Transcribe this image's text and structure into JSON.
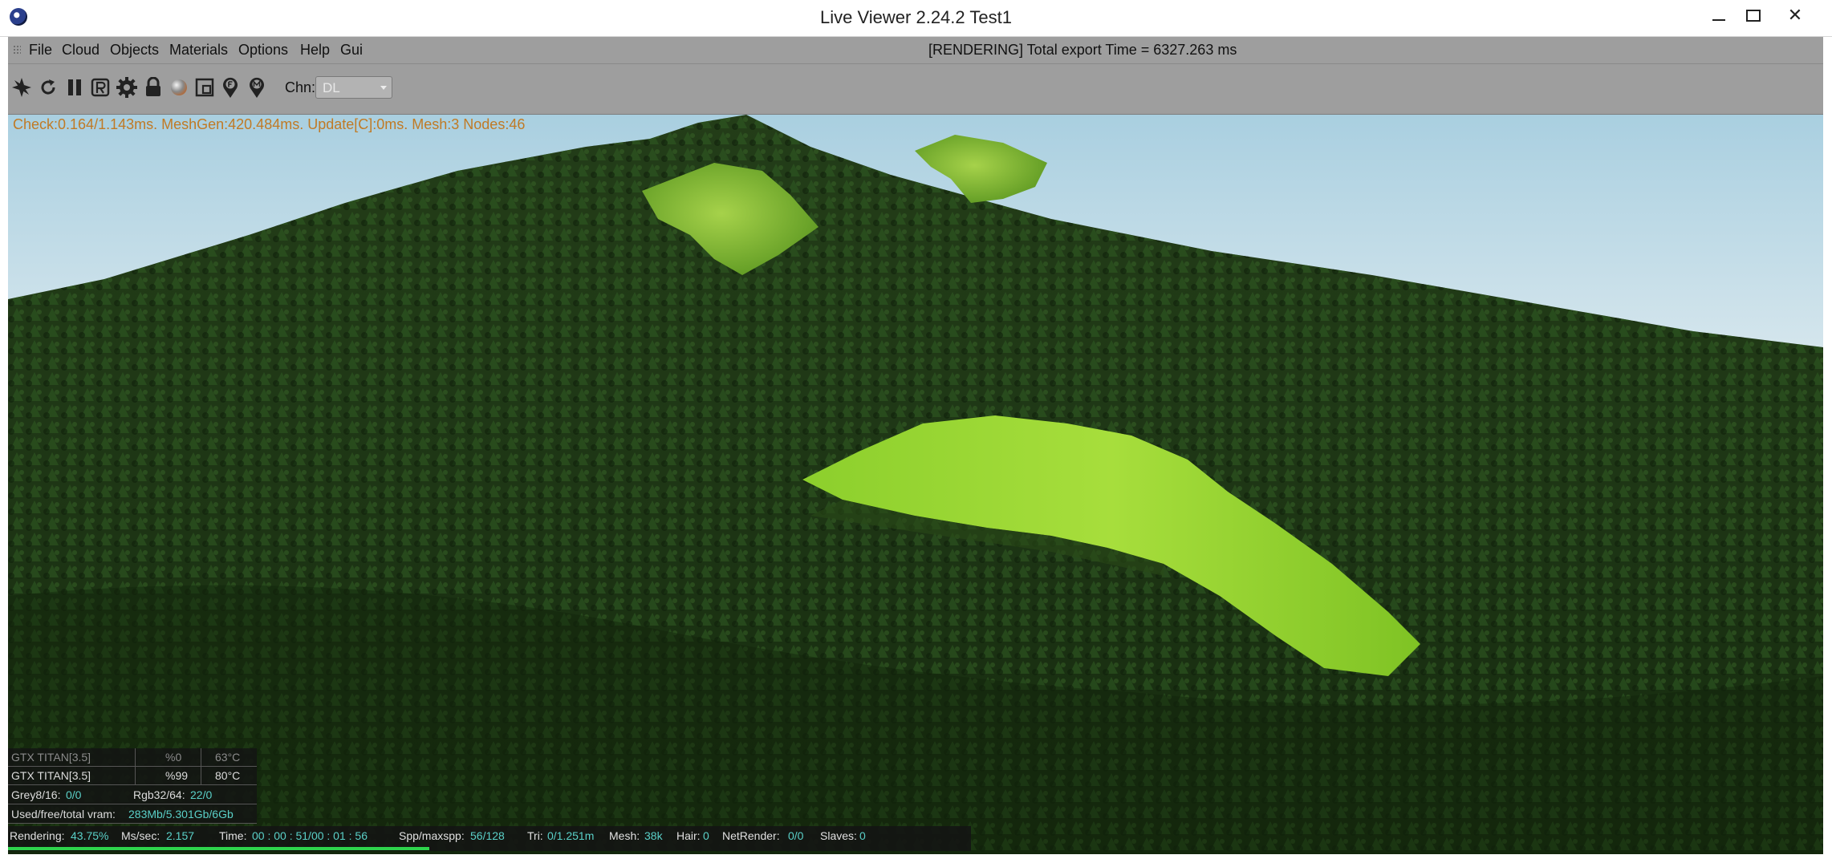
{
  "window": {
    "title": "Live Viewer 2.24.2 Test1",
    "close_glyph": "✕"
  },
  "menu": {
    "items": [
      "File",
      "Cloud",
      "Objects",
      "Materials",
      "Options",
      "Help",
      "Gui"
    ],
    "render_status": "[RENDERING] Total export Time = 6327.263 ms"
  },
  "toolbar": {
    "icons": [
      "aperture-icon",
      "refresh-icon",
      "pause-icon",
      "region-r-icon",
      "gear-icon",
      "lock-icon",
      "material-sphere-icon",
      "resize-icon",
      "pin-f-icon",
      "pin-m-icon"
    ],
    "channel_label": "Chn:",
    "channel_value": "DL"
  },
  "viewport": {
    "perf_stats": "Check:0.164/1.143ms. MeshGen:420.484ms. Update[C]:0ms. Mesh:3 Nodes:46"
  },
  "gpus": [
    {
      "name": "GTX TITAN[3.5]",
      "usage": "%0",
      "temp": "63°C",
      "dim": true
    },
    {
      "name": "GTX TITAN[3.5]",
      "usage": "%99",
      "temp": "80°C",
      "dim": false
    }
  ],
  "buffers": {
    "grey_label": "Grey8/16:",
    "grey_value": "0/0",
    "rgb_label": "Rgb32/64:",
    "rgb_value": "22/0",
    "vram_label": "Used/free/total vram:",
    "vram_value": "283Mb/5.301Gb/6Gb"
  },
  "status": {
    "rendering_label": "Rendering:",
    "rendering_value": "43.75%",
    "mssec_label": "Ms/sec:",
    "mssec_value": "2.157",
    "time_label": "Time:",
    "time_value": "00 : 00 : 51/00 : 01 : 56",
    "spp_label": "Spp/maxspp:",
    "spp_value": "56/128",
    "tri_label": "Tri:",
    "tri_value": "0/1.251m",
    "mesh_label": "Mesh:",
    "mesh_value": "38k",
    "hair_label": "Hair:",
    "hair_value": "0",
    "netrender_label": "NetRender:",
    "netrender_value": "0/0",
    "slaves_label": "Slaves:",
    "slaves_value": "0",
    "progress_fraction": 0.4375
  },
  "colors": {
    "accent_value": "#5ad0c8",
    "progress": "#2ed44c",
    "perf_text": "#c07a25",
    "chrome": "#9e9e9e"
  }
}
